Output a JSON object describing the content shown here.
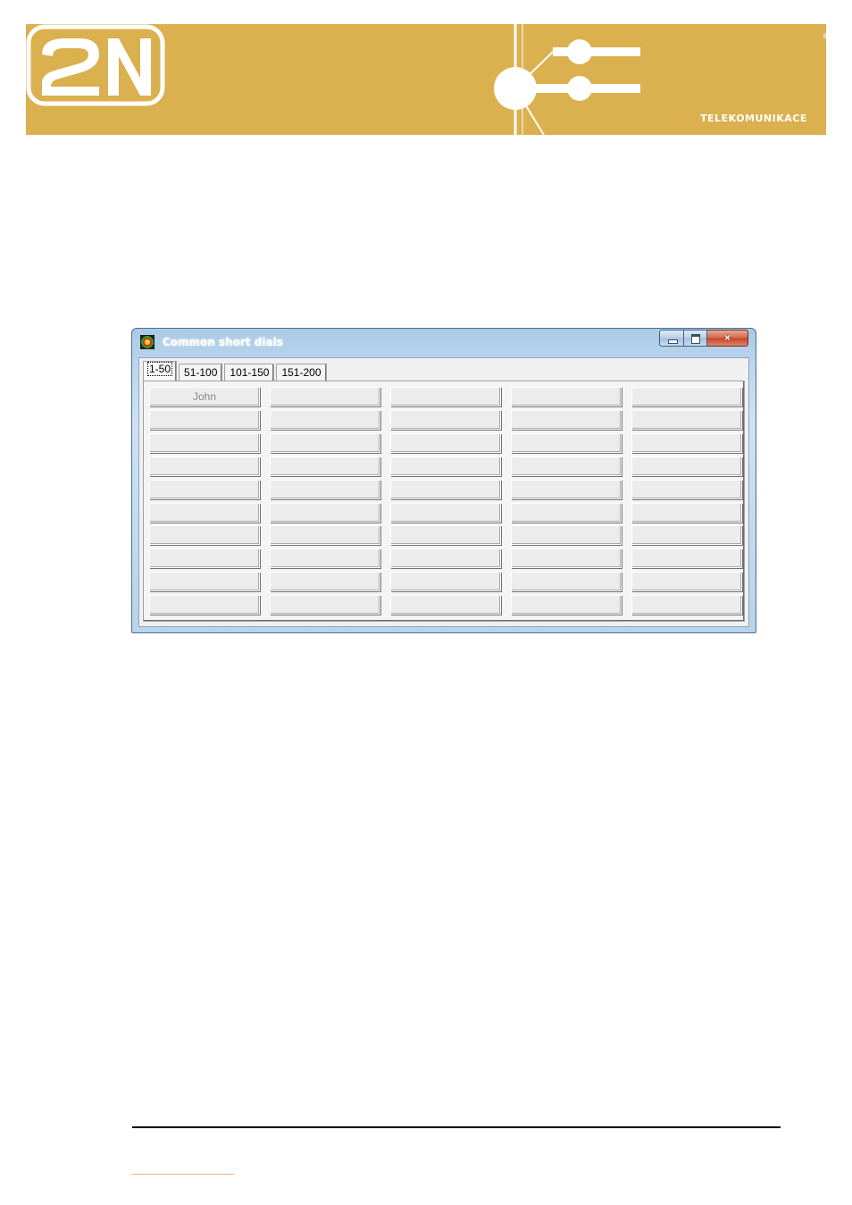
{
  "brand": {
    "logo_text": "2N",
    "tagline": "TELEKOMUNIKACE",
    "registered": "®",
    "colors": {
      "banner": "#dbb04e",
      "white": "#ffffff"
    }
  },
  "window": {
    "title": "Common short dials",
    "icon": "app-icon",
    "buttons": {
      "minimize": "minimize-icon",
      "maximize": "maximize-icon",
      "close": "×"
    }
  },
  "tabs": [
    {
      "label": "1-50",
      "active": true
    },
    {
      "label": "51-100",
      "active": false
    },
    {
      "label": "101-150",
      "active": false
    },
    {
      "label": "151-200",
      "active": false
    }
  ],
  "dials": {
    "rows": 10,
    "columns": 5,
    "labels": [
      "John"
    ]
  }
}
